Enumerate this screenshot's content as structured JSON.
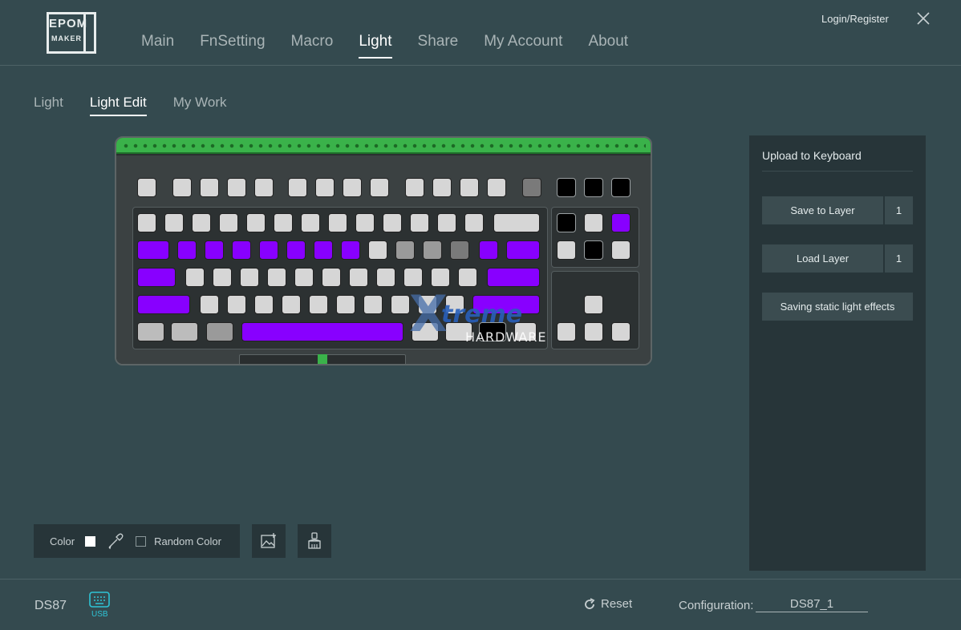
{
  "header": {
    "logo_top": "EPOM",
    "logo_bottom": "MAKER",
    "nav": [
      {
        "label": "Main",
        "active": false
      },
      {
        "label": "FnSetting",
        "active": false
      },
      {
        "label": "Macro",
        "active": false
      },
      {
        "label": "Light",
        "active": true
      },
      {
        "label": "Share",
        "active": false
      },
      {
        "label": "My Account",
        "active": false
      },
      {
        "label": "About",
        "active": false
      }
    ],
    "login_label": "Login/Register",
    "close_icon": "close-icon"
  },
  "sub_tabs": [
    {
      "label": "Light",
      "active": false
    },
    {
      "label": "Light Edit",
      "active": true
    },
    {
      "label": "My Work",
      "active": false
    }
  ],
  "colors": {
    "background": "#344a4f",
    "panel": "#273539",
    "key_white": "#d6d6d6",
    "key_light_gray": "#bcbcbc",
    "key_gray": "#9a9a9a",
    "key_dark_gray": "#7a7a7a",
    "key_black": "#000000",
    "key_purple": "#8800ff",
    "case_accent_green": "#3ab24a",
    "usb_accent": "#2ec4d6"
  },
  "keyboard": {
    "model": "DS87",
    "rows": [
      [
        "W",
        "W",
        "W",
        "W",
        "W",
        "W",
        "W",
        "W",
        "W",
        "W",
        "W",
        "W",
        "W",
        "D",
        "K",
        "K",
        "K"
      ],
      [
        "W",
        "W",
        "W",
        "W",
        "W",
        "W",
        "W",
        "W",
        "W",
        "W",
        "W",
        "W",
        "W",
        "W",
        "K",
        "W",
        "P"
      ],
      [
        "P",
        "P",
        "P",
        "P",
        "P",
        "P",
        "P",
        "P",
        "W",
        "G",
        "G",
        "D",
        "P",
        "P",
        "W",
        "K",
        "W"
      ],
      [
        "P",
        "W",
        "W",
        "W",
        "W",
        "W",
        "W",
        "W",
        "W",
        "W",
        "W",
        "W",
        "P"
      ],
      [
        "P",
        "W",
        "W",
        "W",
        "W",
        "W",
        "W",
        "W",
        "W",
        "W",
        "W",
        "P",
        "W"
      ],
      [
        "L",
        "L",
        "G",
        "P",
        "W",
        "W",
        "K",
        "W",
        "W",
        "W",
        "W",
        "D"
      ]
    ]
  },
  "watermark": {
    "x": "X",
    "treme": "treme",
    "hardware": "HARDWARE"
  },
  "panel": {
    "title": "Upload to Keyboard",
    "save_label": "Save to Layer",
    "save_layer": "1",
    "load_label": "Load Layer",
    "load_layer": "1",
    "static_label": "Saving static light effects"
  },
  "tools": {
    "color_label": "Color",
    "color_value": "#ffffff",
    "random_label": "Random Color",
    "random_checked": false,
    "eyedropper_icon": "eyedropper-icon",
    "image_icon": "image-add-icon",
    "brush_icon": "brush-icon"
  },
  "footer": {
    "device_name": "DS87",
    "usb_label": "USB",
    "reset_label": "Reset",
    "config_label": "Configuration:",
    "config_value": "DS87_1"
  }
}
